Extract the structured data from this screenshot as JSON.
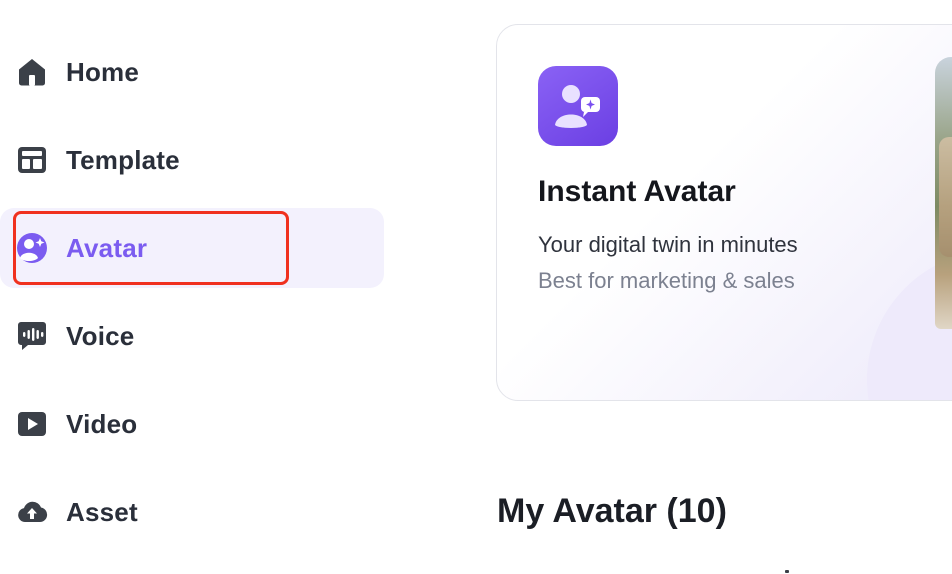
{
  "sidebar": {
    "items": [
      {
        "label": "Home",
        "icon": "home-icon"
      },
      {
        "label": "Template",
        "icon": "template-icon"
      },
      {
        "label": "Avatar",
        "icon": "avatar-icon",
        "active": true
      },
      {
        "label": "Voice",
        "icon": "voice-icon"
      },
      {
        "label": "Video",
        "icon": "video-icon"
      },
      {
        "label": "Asset",
        "icon": "asset-upload-icon"
      }
    ],
    "active_color": "#7b5cf0",
    "highlight_color": "#f0311f"
  },
  "card": {
    "icon": "instant-avatar-icon",
    "title": "Instant Avatar",
    "subtitle": "Your digital twin in minutes",
    "note": "Best for marketing & sales",
    "accent": "#7a4ff0"
  },
  "my_avatar": {
    "title": "My Avatar (10)"
  }
}
